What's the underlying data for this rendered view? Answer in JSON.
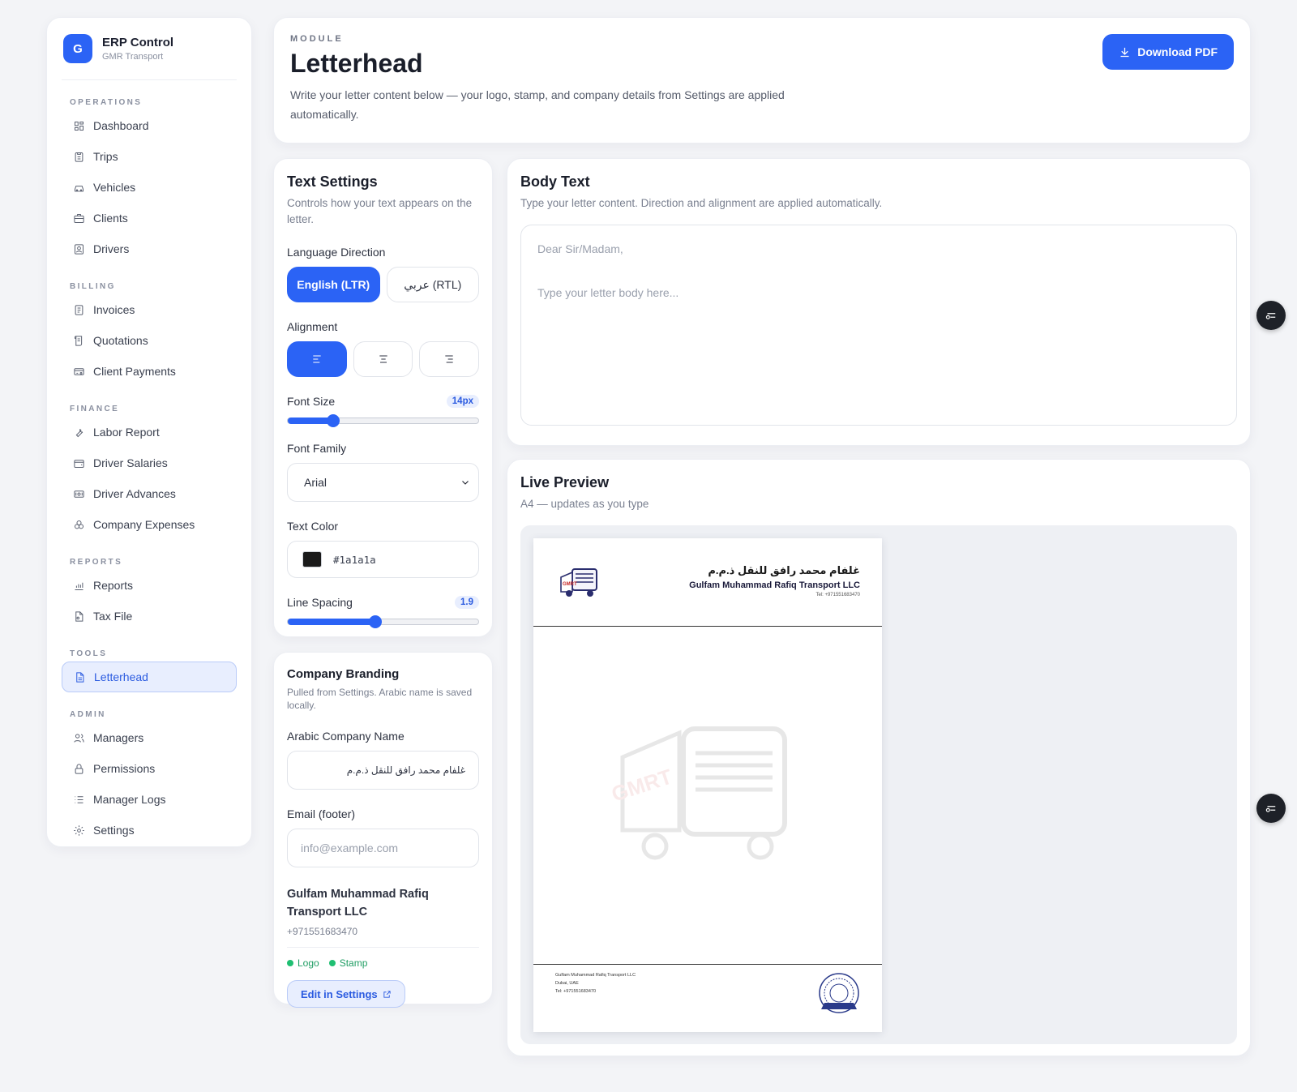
{
  "brand": {
    "logo_letter": "G",
    "title": "ERP Control",
    "subtitle": "GMR Transport"
  },
  "sidebar": {
    "sections": [
      {
        "label": "OPERATIONS",
        "items": [
          {
            "label": "Dashboard",
            "icon": "dashboard-icon"
          },
          {
            "label": "Trips",
            "icon": "clipboard-icon"
          },
          {
            "label": "Vehicles",
            "icon": "car-icon"
          },
          {
            "label": "Clients",
            "icon": "briefcase-icon"
          },
          {
            "label": "Drivers",
            "icon": "id-badge-icon"
          }
        ]
      },
      {
        "label": "BILLING",
        "items": [
          {
            "label": "Invoices",
            "icon": "invoice-icon"
          },
          {
            "label": "Quotations",
            "icon": "scroll-icon"
          },
          {
            "label": "Client Payments",
            "icon": "payment-icon"
          }
        ]
      },
      {
        "label": "FINANCE",
        "items": [
          {
            "label": "Labor Report",
            "icon": "wrench-icon"
          },
          {
            "label": "Driver Salaries",
            "icon": "wallet-icon"
          },
          {
            "label": "Driver Advances",
            "icon": "cash-icon"
          },
          {
            "label": "Company Expenses",
            "icon": "coins-icon"
          }
        ]
      },
      {
        "label": "REPORTS",
        "items": [
          {
            "label": "Reports",
            "icon": "chart-icon"
          },
          {
            "label": "Tax File",
            "icon": "file-icon"
          }
        ]
      },
      {
        "label": "TOOLS",
        "items": [
          {
            "label": "Letterhead",
            "icon": "document-icon",
            "active": true
          }
        ]
      },
      {
        "label": "ADMIN",
        "items": [
          {
            "label": "Managers",
            "icon": "users-icon"
          },
          {
            "label": "Permissions",
            "icon": "lock-icon"
          },
          {
            "label": "Manager Logs",
            "icon": "list-icon"
          },
          {
            "label": "Settings",
            "icon": "gear-icon"
          }
        ]
      }
    ]
  },
  "header": {
    "eyebrow": "MODULE",
    "title": "Letterhead",
    "description": "Write your letter content below — your logo, stamp, and company details from Settings are applied automatically.",
    "download_label": "Download PDF"
  },
  "text_settings": {
    "title": "Text Settings",
    "subtitle": "Controls how your text appears on the letter.",
    "direction_label": "Language Direction",
    "direction_options": [
      "English (LTR)",
      "عربي (RTL)"
    ],
    "direction_selected": 0,
    "alignment_label": "Alignment",
    "alignment_options": [
      "align-left-icon",
      "align-center-icon",
      "align-right-icon"
    ],
    "alignment_selected": 0,
    "font_size_label": "Font Size",
    "font_size_value": "14px",
    "font_size_fraction": 0.24,
    "font_family_label": "Font Family",
    "font_family_value": "Arial",
    "text_color_label": "Text Color",
    "text_color_value": "#1a1a1a",
    "line_spacing_label": "Line Spacing",
    "line_spacing_value": "1.9",
    "line_spacing_fraction": 0.46
  },
  "branding": {
    "title": "Company Branding",
    "subtitle": "Pulled from Settings. Arabic name is saved locally.",
    "arabic_label": "Arabic Company Name",
    "arabic_value": "غلفام محمد رافق للنقل ذ.م.م",
    "email_label": "Email (footer)",
    "email_placeholder": "info@example.com",
    "company_name": "Gulfam Muhammad Rafiq Transport LLC",
    "phone": "+971551683470",
    "status_logo": "Logo",
    "status_stamp": "Stamp",
    "edit_label": "Edit in Settings"
  },
  "body_text": {
    "title": "Body Text",
    "subtitle": "Type your letter content. Direction and alignment are applied automatically.",
    "placeholder_greeting": "Dear Sir/Madam,",
    "placeholder_body": "Type your letter body here..."
  },
  "preview": {
    "title": "Live Preview",
    "subtitle": "A4 — updates as you type",
    "company_ar": "غلفام محمد رافق للنقل ذ.م.م",
    "company_en": "Gulfam Muhammad Rafiq Transport LLC",
    "tel": "Tel: +971551683470",
    "footer_company": "Gulfam Muhammad Rafiq Transport LLC",
    "footer_city": "Dubai, UAE",
    "footer_tel": "Tel: +971551683470",
    "logo_text": "GMRT"
  },
  "colors": {
    "accent": "#2b63f5",
    "accent_soft": "#e8eefe",
    "success": "#1fbf72",
    "fab": "#1e2128"
  }
}
